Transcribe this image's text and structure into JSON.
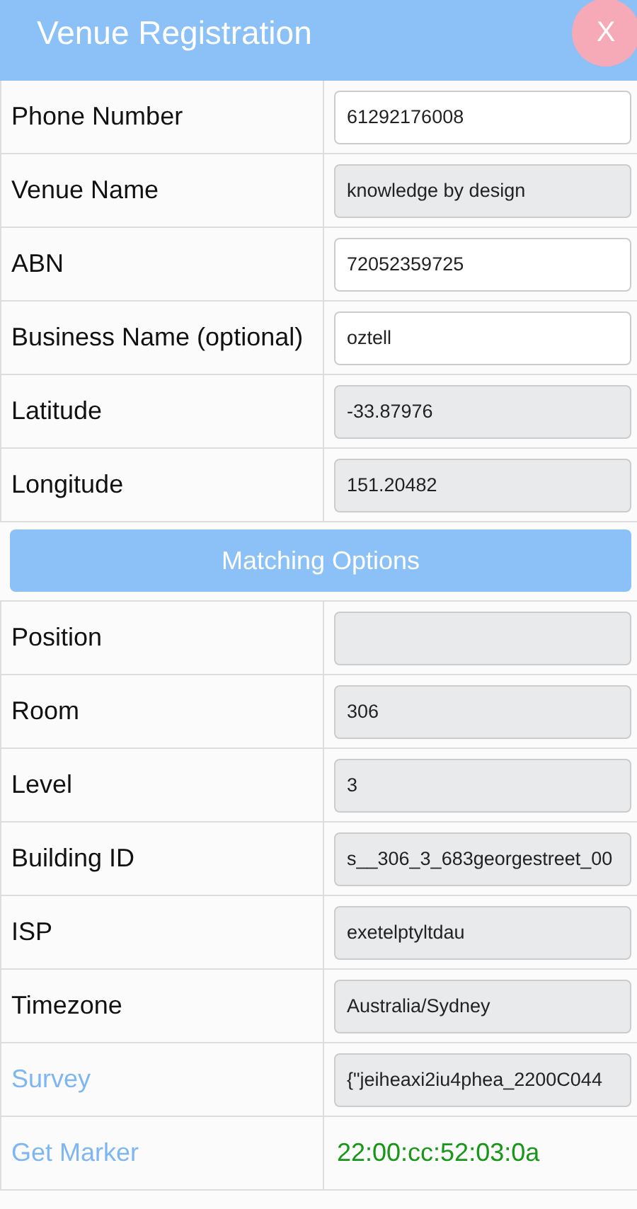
{
  "header": {
    "title": "Venue Registration",
    "close_label": "X"
  },
  "rows": [
    {
      "kind": "field",
      "label": "Phone Number",
      "value": "61292176008",
      "disabled": false
    },
    {
      "kind": "field",
      "label": "Venue Name",
      "value": "knowledge by design",
      "disabled": true
    },
    {
      "kind": "field",
      "label": "ABN",
      "value": "72052359725",
      "disabled": false
    },
    {
      "kind": "field",
      "label": "Business Name (optional)",
      "value": "oztell",
      "disabled": false
    },
    {
      "kind": "field",
      "label": "Latitude",
      "value": "-33.87976",
      "disabled": true
    },
    {
      "kind": "field",
      "label": "Longitude",
      "value": "151.20482",
      "disabled": true
    },
    {
      "kind": "button",
      "label": "Matching Options"
    },
    {
      "kind": "field",
      "label": "Position",
      "value": "",
      "disabled": true
    },
    {
      "kind": "field",
      "label": "Room",
      "value": "306",
      "disabled": true
    },
    {
      "kind": "field",
      "label": "Level",
      "value": "3",
      "disabled": true
    },
    {
      "kind": "field",
      "label": "Building ID",
      "value": "s__306_3_683georgestreet_00",
      "disabled": true
    },
    {
      "kind": "field",
      "label": "ISP",
      "value": "exetelptyltdau",
      "disabled": true
    },
    {
      "kind": "field",
      "label": "Timezone",
      "value": "Australia/Sydney",
      "disabled": true
    },
    {
      "kind": "link-field",
      "label": "Survey",
      "value": "{\"jeiheaxi2iu4phea_2200C044",
      "disabled": true
    },
    {
      "kind": "link-text",
      "label": "Get Marker",
      "value": "22:00:cc:52:03:0a"
    }
  ]
}
